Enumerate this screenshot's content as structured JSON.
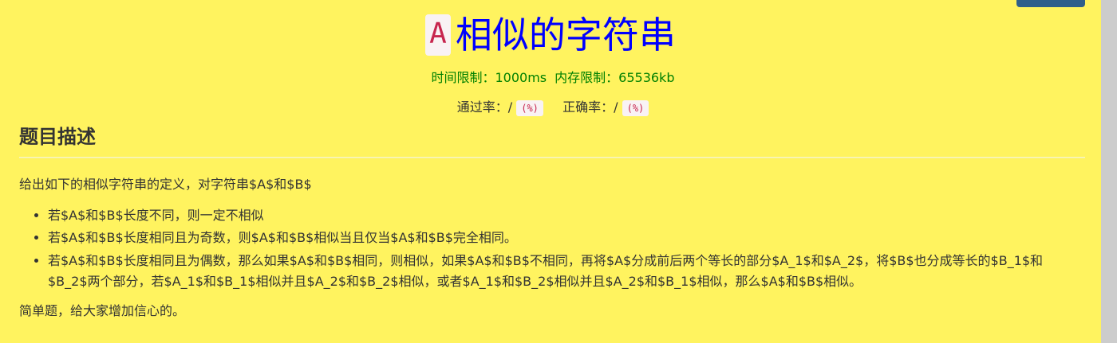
{
  "problem": {
    "label": "A",
    "title": "相似的字符串",
    "time_limit": "时间限制：1000ms",
    "memory_limit": "内存限制：65536kb",
    "pass_rate_label": "通过率：/",
    "pass_rate_pct": "(%)",
    "correct_rate_label": "正确率：/",
    "correct_rate_pct": "(%)"
  },
  "section": {
    "heading": "题目描述"
  },
  "description": {
    "intro": "给出如下的相似字符串的定义，对字符串$A$和$B$",
    "bullets": [
      "若$A$和$B$长度不同，则一定不相似",
      "若$A$和$B$长度相同且为奇数，则$A$和$B$相似当且仅当$A$和$B$完全相同。",
      "若$A$和$B$长度相同且为偶数，那么如果$A$和$B$相同，则相似，如果$A$和$B$不相同，再将$A$分成前后两个等长的部分$A_1$和$A_2$，将$B$也分成等长的$B_1$和$B_2$两个部分，若$A_1$和$B_1$相似并且$A_2$和$B_2$相似，或者$A_1$和$B_2$相似并且$A_2$和$B_1$相似，那么$A$和$B$相似。"
    ],
    "note": "简单题，给大家增加信心的。"
  },
  "colors": {
    "background": "#fff35f",
    "title": "#0000ff",
    "limits": "#008000",
    "badge_text": "#c7254e",
    "badge_bg": "#f9f2f4"
  }
}
